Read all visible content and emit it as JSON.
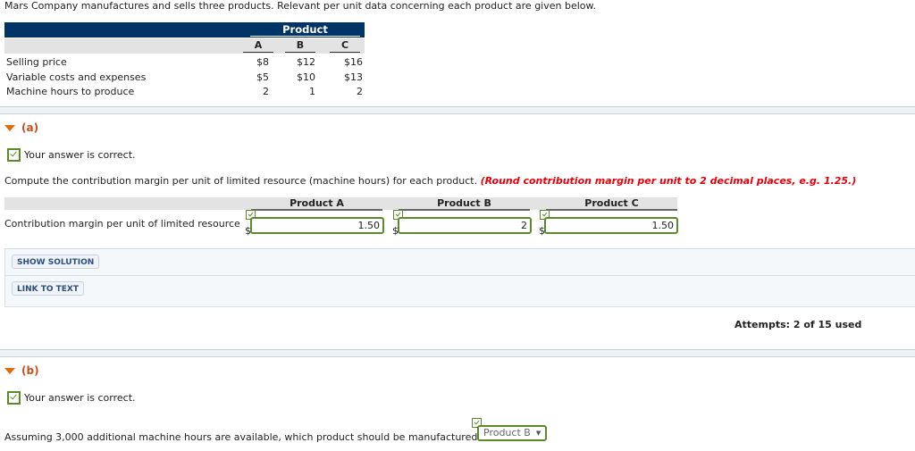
{
  "intro": "Mars Company manufactures and sells three products. Relevant per unit data concerning each product are given below.",
  "product_table": {
    "group_header": "Product",
    "columns": [
      "A",
      "B",
      "C"
    ],
    "rows": [
      {
        "label": "Selling price",
        "values": [
          "$8",
          "$12",
          "$16"
        ]
      },
      {
        "label": "Variable costs and expenses",
        "values": [
          "$5",
          "$10",
          "$13"
        ]
      },
      {
        "label": "Machine hours to produce",
        "values": [
          "2",
          "1",
          "2"
        ]
      }
    ]
  },
  "part_a": {
    "label": "(a)",
    "status": "Your answer is correct.",
    "instruction": "Compute the contribution margin per unit of limited resource (machine hours) for each product.",
    "instruction_note": "(Round contribution margin per unit to 2 decimal places, e.g. 1.25.)",
    "columns": [
      "Product A",
      "Product B",
      "Product C"
    ],
    "row_label": "Contribution margin per unit of limited resource",
    "currency": "$",
    "answers": [
      "1.50",
      "2",
      "1.50"
    ],
    "buttons": {
      "show_solution": "SHOW SOLUTION",
      "link_to_text": "LINK TO TEXT"
    },
    "attempts": "Attempts: 2 of 15 used"
  },
  "part_b": {
    "label": "(b)",
    "status": "Your answer is correct.",
    "question": "Assuming 3,000 additional machine hours are available, which product should be manufactured?",
    "selected": "Product B"
  },
  "colors": {
    "navy_header": "#003366",
    "correct_green": "#5b8a2b",
    "part_orange": "#c8501e",
    "note_red": "#e8000b"
  }
}
